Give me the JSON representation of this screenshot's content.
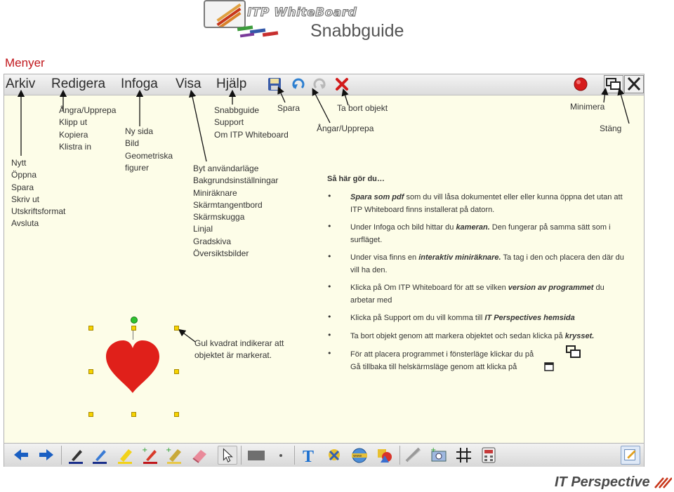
{
  "header": {
    "logo_text": "ITP WhiteBoard",
    "subtitle": "Snabbguide",
    "section_title": "Menyer"
  },
  "menubar": {
    "items": [
      {
        "label": "Arkiv"
      },
      {
        "label": "Redigera"
      },
      {
        "label": "Infoga"
      },
      {
        "label": "Visa"
      },
      {
        "label": "Hjälp"
      }
    ],
    "icons": [
      "save-icon",
      "undo-icon",
      "redo-icon",
      "delete-icon",
      "record-icon",
      "window-mode-icon",
      "close-icon"
    ]
  },
  "annotations": {
    "arkiv": [
      "Nytt",
      "Öppna",
      "Spara",
      "Skriv ut",
      "Utskriftsformat",
      "Avsluta"
    ],
    "redigera": [
      "Ångra/Upprepa",
      "Klipp ut",
      "Kopiera",
      "Klistra in"
    ],
    "infoga": [
      "Ny sida",
      "Bild",
      "Geometriska",
      "figurer"
    ],
    "visa": [
      "Byt användarläge",
      "Bakgrundsinställningar",
      "Miniräknare",
      "Skärmtangentbord",
      "Skärmskugga",
      "Linjal",
      "Gradskiva",
      "Översiktsbilder"
    ],
    "hjalp": [
      "Snabbguide",
      "Support",
      "Om ITP Whiteboard"
    ],
    "spara": "Spara",
    "ta_bort": "Ta bort objekt",
    "angra": "Ångar/Upprepa",
    "minimera": "Minimera",
    "stang": "Stäng",
    "selection_note": [
      "Gul kvadrat indikerar att",
      "objektet är markerat."
    ]
  },
  "howto": {
    "title": "Så här gör du…",
    "items": [
      {
        "bold": "Spara som pdf",
        "text": " som du vill låsa dokumentet eller eller kunna öppna det utan att ITP Whiteboard finns installerat på datorn."
      },
      {
        "pre": "Under Infoga och bild hittar du ",
        "bold": "kameran.",
        "text": " Den fungerar på samma sätt som i surfläget."
      },
      {
        "pre": "Under visa finns en ",
        "bold": "interaktiv miniräknare.",
        "text": " Ta tag i den och placera den där du vill ha den."
      },
      {
        "pre": "Klicka på Om ITP Whiteboard för att se vilken ",
        "bold": "version av programmet",
        "text": " du arbetar med"
      },
      {
        "pre": "Klicka på Support om du vill komma till ",
        "bold": "IT Perspectives hemsida",
        "text": ""
      },
      {
        "pre": "Ta bort objekt genom att markera objektet och sedan klicka på ",
        "bold": "krysset.",
        "text": ""
      },
      {
        "pre": "För att placera programmet i fönsterläge klickar du på",
        "bold": "",
        "text": ""
      },
      {
        "pre": "Gå tillbaka till helskärmsläge genom att klicka på",
        "bold": "",
        "text": ""
      }
    ]
  },
  "toolbar_bottom": {
    "tools": [
      "back-arrow-icon",
      "forward-arrow-icon",
      "pen-black-icon",
      "pen-blue-icon",
      "highlighter-yellow-icon",
      "pen-red-add-icon",
      "highlighter-add-icon",
      "eraser-icon",
      "pointer-icon",
      "rectangle-shape-icon",
      "dot-size-icon",
      "text-tool-icon",
      "stamp-icon",
      "web-icon",
      "shapes-icon",
      "protractor-icon",
      "camera-icon",
      "grid-icon",
      "calculator-icon",
      "edit-icon"
    ]
  },
  "colors": {
    "accent_red": "#c0161b",
    "canvas_bg": "#fdfde8",
    "selection_handle": "#f6d200",
    "heart": "#e0201a"
  },
  "footer": {
    "brand": "IT Perspective"
  }
}
